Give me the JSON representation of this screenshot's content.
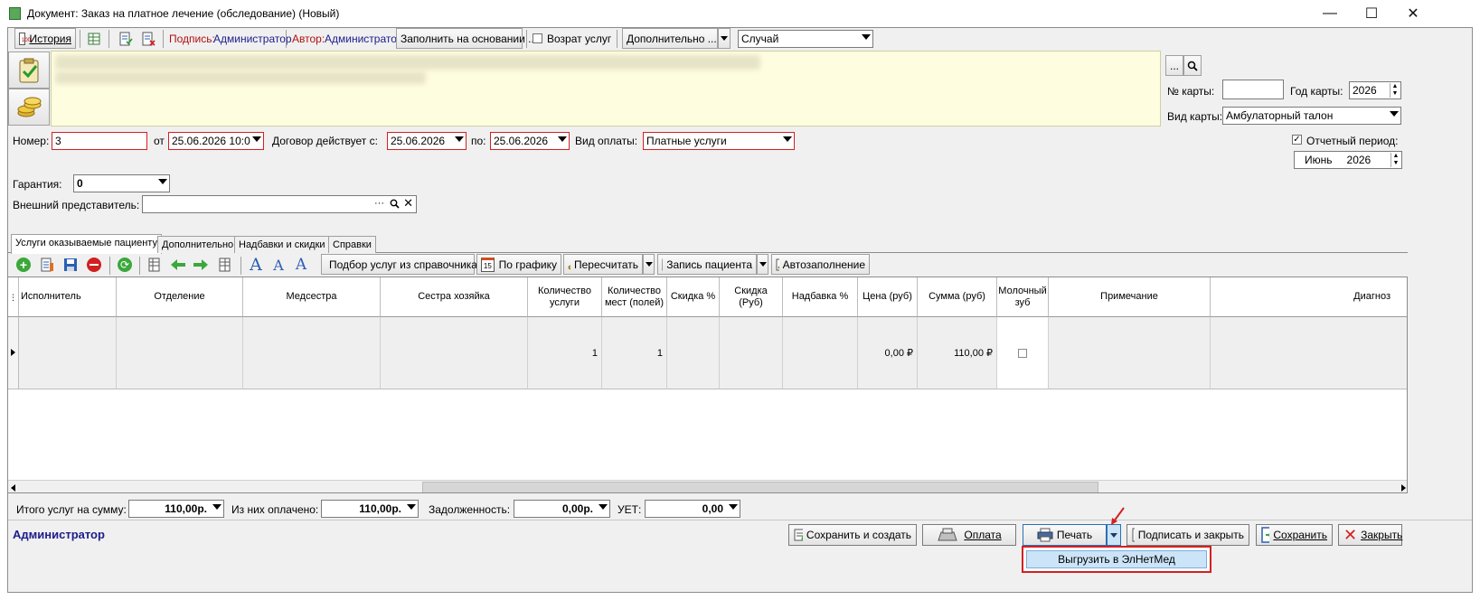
{
  "window": {
    "title": "Документ: Заказ на платное лечение (обследование) (Новый)",
    "controls": [
      "minimize-icon",
      "maximize-icon",
      "close-icon"
    ]
  },
  "toolbar": {
    "history_label": "История",
    "sign_label": "Подпись:",
    "sign_value": "Администратор",
    "author_label": "Автор:",
    "author_value": "Администратор",
    "fill_basis_label": "Заполнить на основании ...",
    "refund_label": "Возрат услуг",
    "extra_label": "Дополнительно ...",
    "case_value": "Случай"
  },
  "card": {
    "dots_label": "...",
    "card_no_label": "№ карты:",
    "card_no_value": "",
    "card_year_label": "Год карты:",
    "card_year_value": "2026",
    "card_type_label": "Вид карты:",
    "card_type_value": "Амбулаторный талон"
  },
  "form": {
    "number_label": "Номер:",
    "number_value": "3",
    "from_label": "от",
    "from_value": "25.06.2026 10:0",
    "contract_label": "Договор действует с:",
    "contract_from": "25.06.2026",
    "to_label": "по:",
    "contract_to": "25.06.2026",
    "payment_label": "Вид оплаты:",
    "payment_value": "Платные услуги",
    "report_period_label": "Отчетный период:",
    "report_month": "Июнь",
    "report_year": "2026",
    "guarantee_label": "Гарантия:",
    "guarantee_value": "0",
    "external_rep_label": "Внешний представитель:",
    "external_rep_value": "",
    "external_rep_dots": "···"
  },
  "tabs": [
    {
      "label": "Услуги оказываемые пациенту"
    },
    {
      "label": "Дополнительно"
    },
    {
      "label": "Надбавки и скидки"
    },
    {
      "label": "Справки"
    }
  ],
  "services_toolbar": {
    "pick_label": "Подбор услуг из справочника",
    "schedule_label": "По графику",
    "recalc_label": "Пересчитать",
    "appointment_label": "Запись пациента",
    "autofill_label": "Автозаполнение",
    "calendar_day": "15"
  },
  "grid": {
    "columns": [
      "Исполнитель",
      "Отделение",
      "Медсестра",
      "Сестра хозяйка",
      "Количество услуги",
      "Количество мест (полей)",
      "Скидка %",
      "Скидка (Руб)",
      "Надбавка %",
      "Цена (руб)",
      "Сумма (руб)",
      "Молочный зуб",
      "Примечание",
      "Диагноз"
    ],
    "rows": [
      [
        "",
        "",
        "",
        "",
        "1",
        "1",
        "",
        "",
        "",
        "0,00 ₽",
        "110,00 ₽",
        "",
        "",
        ""
      ]
    ]
  },
  "totals": {
    "total_label": "Итого услуг на сумму:",
    "total_value": "110,00р.",
    "paid_label": "Из них оплачено:",
    "paid_value": "110,00р.",
    "debt_label": "Задолженность:",
    "debt_value": "0,00р.",
    "uet_label": "УЕТ:",
    "uet_value": "0,00"
  },
  "footer": {
    "user": "Администратор",
    "save_create_label": "Сохранить и создать",
    "payment_btn_label": "Оплата",
    "print_label": "Печать",
    "sign_close_label": "Подписать и закрыть",
    "save_label": "Сохранить",
    "close_label": "Закрыть",
    "dropdown_item": "Выгрузить в ЭлНетМед"
  },
  "colors": {
    "accent_blue": "#1c1c8c",
    "required_red": "#d42020",
    "highlight": "#cce4f7",
    "callout": "#d42020"
  }
}
